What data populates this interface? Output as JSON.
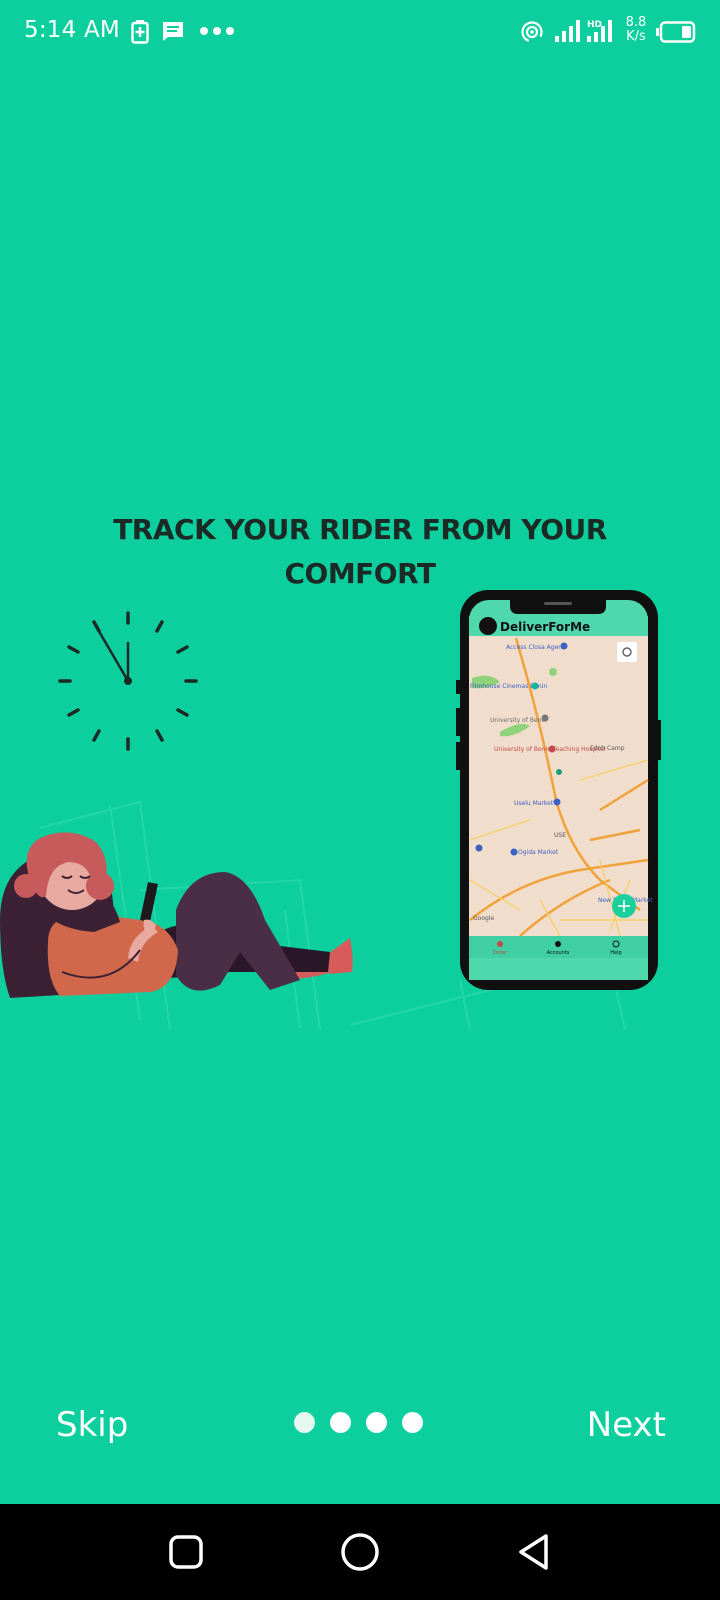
{
  "status_bar": {
    "time": "5:14 AM",
    "net_speed_value": "8.8",
    "net_speed_unit": "K/s",
    "icons": [
      "battery-saver-icon",
      "message-icon",
      "more-dots-icon",
      "hotspot-icon",
      "signal-icon",
      "signal-hd-icon",
      "battery-icon"
    ]
  },
  "onboarding": {
    "headline_line1": "TRACK YOUR RIDER FROM YOUR",
    "headline_line2": "COMFORT",
    "phone_app_name": "DeliverForMe",
    "map_labels": {
      "place_1": "Access Closa Agent",
      "place_2": "Filmhouse Cinemas Benin",
      "place_3": "University of Benin",
      "place_4": "University of Benin Teaching Hospital",
      "place_5": "Edoh Camp",
      "place_6": "Uselu Market",
      "place_7": "USE",
      "place_8": "Ogida Market",
      "place_9": "New Benin Market",
      "map_credit": "Google"
    },
    "phone_tabs": [
      "Order",
      "Accounts",
      "Help"
    ]
  },
  "controls": {
    "skip_label": "Skip",
    "next_label": "Next",
    "page_count": 4,
    "active_page": 1
  },
  "colors": {
    "background": "#0ccf9d",
    "headline": "#1b2a24",
    "map_route": "#f0a23b"
  },
  "nav_bar": {
    "icons": [
      "recents-square-icon",
      "home-circle-icon",
      "back-triangle-icon"
    ]
  }
}
